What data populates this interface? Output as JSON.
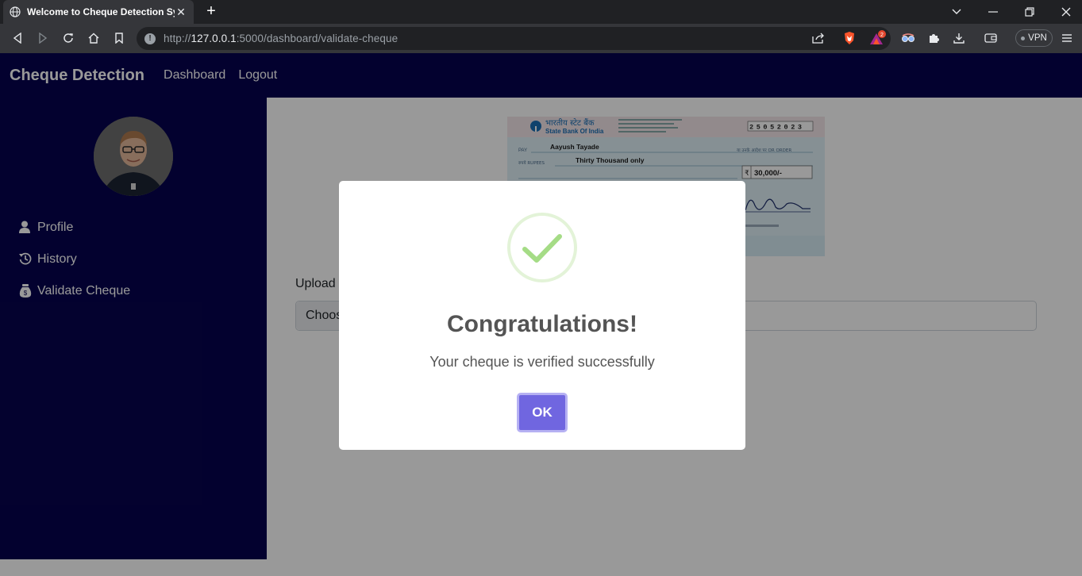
{
  "browser": {
    "tab_title": "Welcome to Cheque Detection Sy",
    "tab_close": "✕",
    "new_tab": "+",
    "url_scheme": "http://",
    "url_host": "127.0.0.1",
    "url_rest": ":5000/dashboard/validate-cheque",
    "notification_count": "2",
    "vpn_label": "VPN"
  },
  "navbar": {
    "brand": "Cheque Detection",
    "links": [
      "Dashboard",
      "Logout"
    ]
  },
  "sidebar": {
    "items": [
      {
        "label": "Profile",
        "icon": "person-icon"
      },
      {
        "label": "History",
        "icon": "history-icon"
      },
      {
        "label": "Validate Cheque",
        "icon": "money-bag-icon"
      }
    ]
  },
  "main": {
    "cheque": {
      "bank_hindi": "भारतीय स्टेट बैंक",
      "bank_name": "State Bank Of India",
      "date": "25052023",
      "pay_label": "PAY",
      "payee": "Aayush Tayade",
      "rupees_label": "रुपये RUPEES",
      "amount_words": "Thirty Thousand only",
      "amount": "30,000/-",
      "order_text": "या उनके आदेश पर OR ORDER"
    },
    "upload_label": "Upload",
    "file_button": "Choos"
  },
  "modal": {
    "title": "Congratulations!",
    "message": "Your cheque is verified successfully",
    "ok_label": "OK"
  }
}
